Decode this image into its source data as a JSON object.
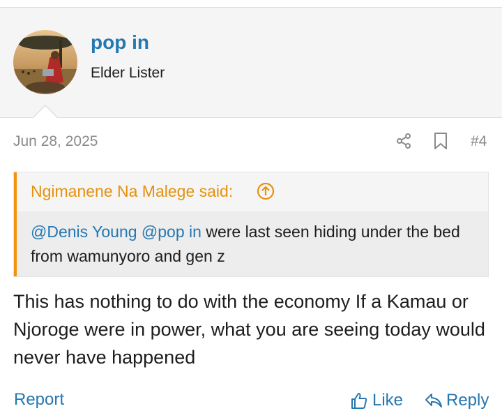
{
  "user": {
    "name": "pop in",
    "title": "Elder Lister"
  },
  "post": {
    "date": "Jun 28, 2025",
    "number": "#4"
  },
  "quote": {
    "author_said": "Ngimanene Na Malege said:",
    "mention1": "@Denis Young",
    "mention2": "@pop in",
    "text_rest": " were last seen hiding under the bed from wamunyoro and gen z"
  },
  "message": {
    "text": "This has nothing to do with the economy If a Kamau or Njoroge were in power, what you are seeing today would never have happened"
  },
  "footer": {
    "report_label": "Report",
    "like_label": "Like",
    "reply_label": "Reply"
  },
  "colors": {
    "link": "#2577b1",
    "quote_accent": "#f2930d"
  },
  "icons": {
    "share": "share-icon",
    "bookmark": "bookmark-icon",
    "quote_jump": "arrow-up-circle-icon",
    "like": "thumbs-up-icon",
    "reply": "reply-icon"
  }
}
